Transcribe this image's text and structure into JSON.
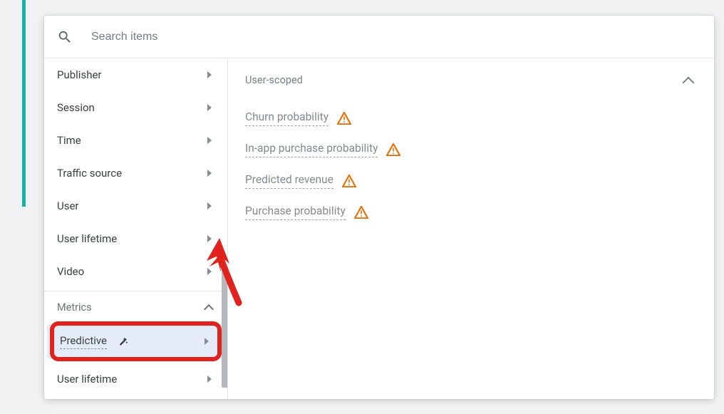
{
  "search": {
    "placeholder": "Search items"
  },
  "sidebar": {
    "categories": [
      {
        "label": "Publisher"
      },
      {
        "label": "Session"
      },
      {
        "label": "Time"
      },
      {
        "label": "Traffic source"
      },
      {
        "label": "User"
      },
      {
        "label": "User lifetime"
      },
      {
        "label": "Video"
      }
    ],
    "metrics_section_label": "Metrics",
    "predictive_label": "Predictive",
    "user_lifetime2": "User lifetime"
  },
  "content": {
    "scope_label": "User-scoped",
    "metrics": [
      {
        "label": "Churn probability"
      },
      {
        "label": "In-app purchase probability"
      },
      {
        "label": "Predicted revenue"
      },
      {
        "label": "Purchase probability"
      }
    ]
  }
}
